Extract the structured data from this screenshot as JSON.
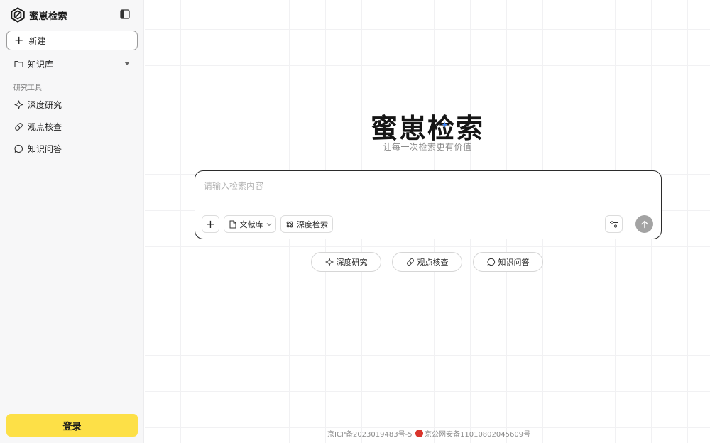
{
  "app": {
    "name": "蜜崽检索"
  },
  "sidebar": {
    "new_label": "新建",
    "knowledge_base_label": "知识库",
    "section_title": "研究工具",
    "tools": [
      {
        "label": "深度研究",
        "icon": "sparkle-icon"
      },
      {
        "label": "观点核查",
        "icon": "pill-icon"
      },
      {
        "label": "知识问答",
        "icon": "chat-bubble-icon"
      }
    ],
    "login_label": "登录"
  },
  "hero": {
    "title": "蜜崽检索",
    "subtitle": "让每一次检索更有价值"
  },
  "search": {
    "placeholder": "请输入检索内容",
    "value": "",
    "doc_library_label": "文献库",
    "deep_search_label": "深度检索"
  },
  "quick_actions": [
    {
      "label": "深度研究",
      "icon": "sparkle-icon"
    },
    {
      "label": "观点核查",
      "icon": "pill-icon"
    },
    {
      "label": "知识问答",
      "icon": "chat-bubble-icon"
    }
  ],
  "footer": {
    "icp": "京ICP备2023019483号-5",
    "police": "京公网安备11010802045609号"
  },
  "colors": {
    "accent": "#fde047",
    "sidebar_bg": "#f7f7f8",
    "send_button": "#a3a3a3"
  }
}
